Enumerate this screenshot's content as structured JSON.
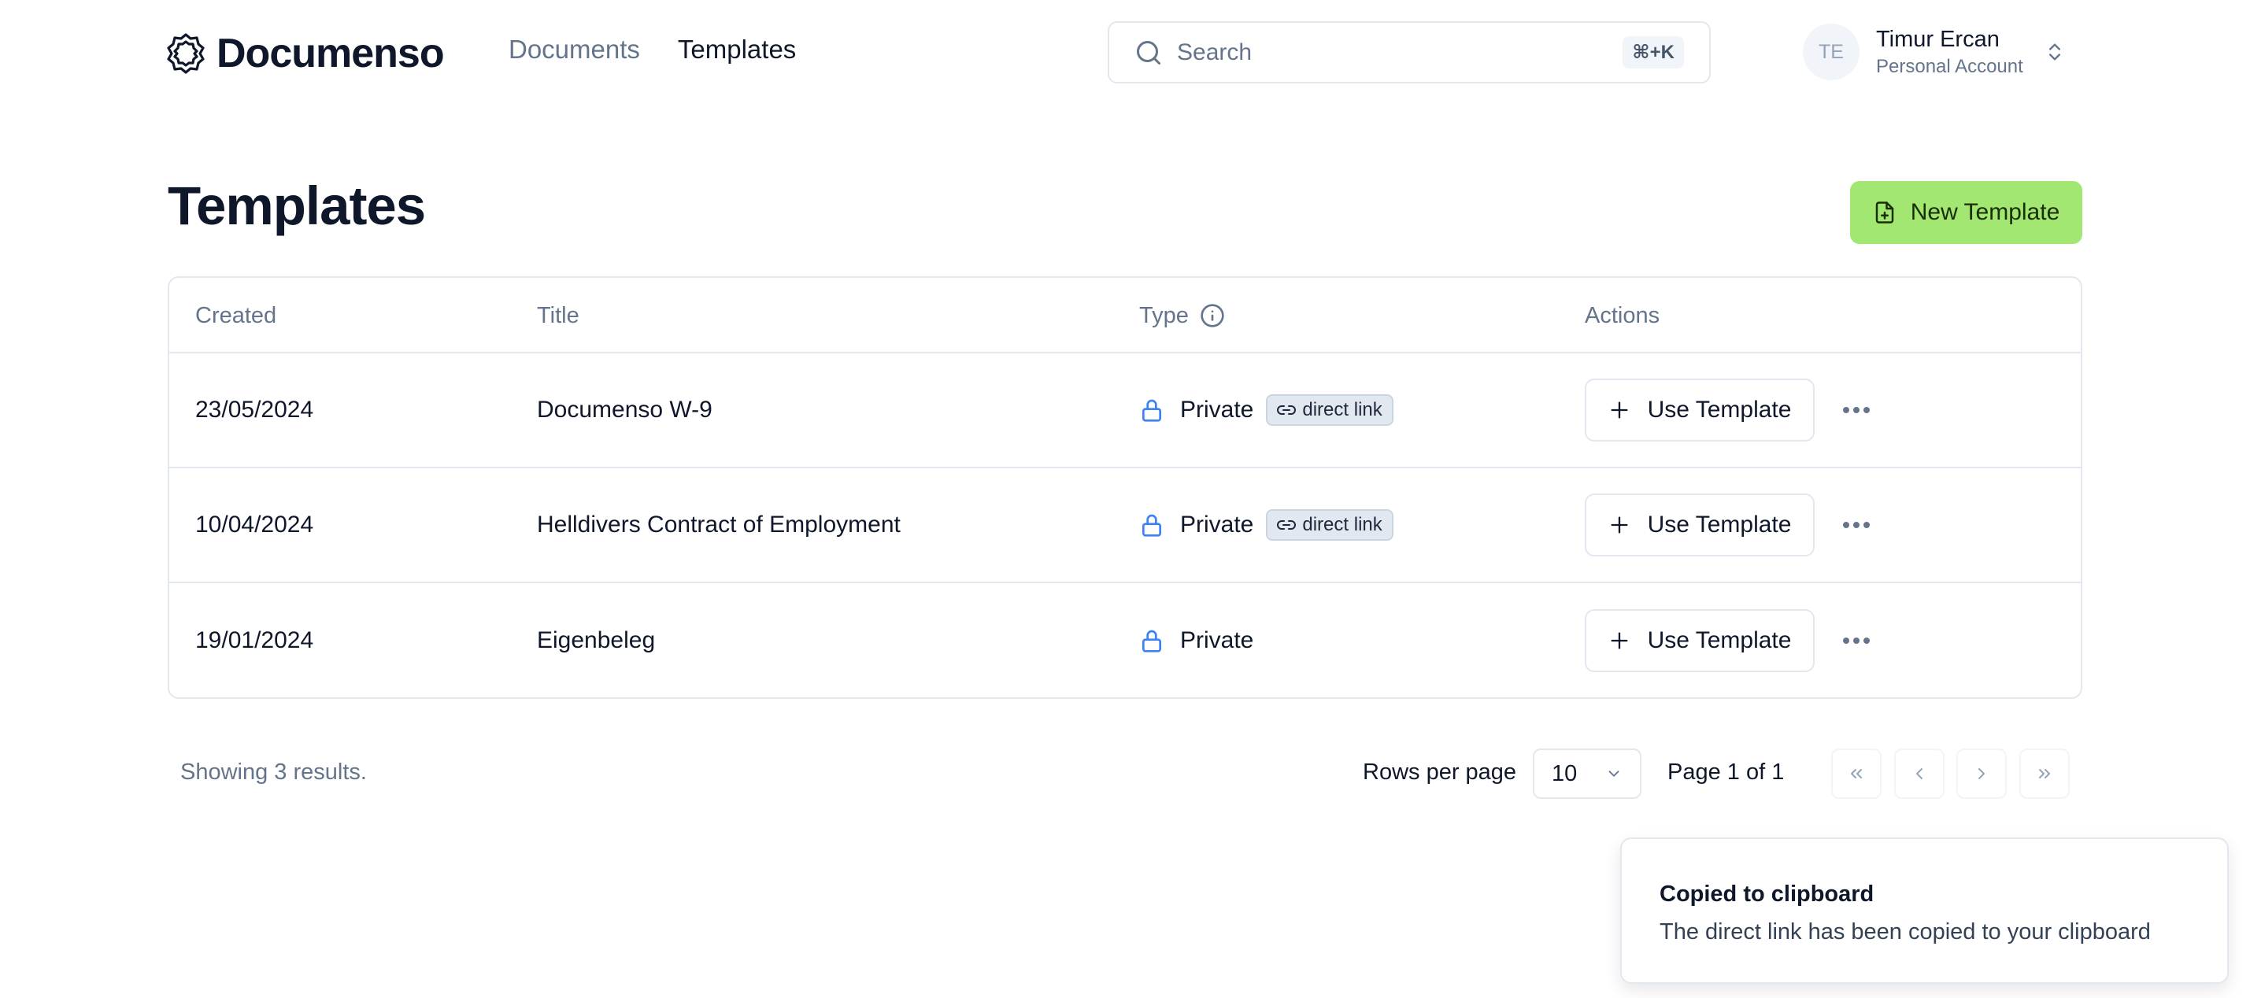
{
  "header": {
    "brand": "Documenso",
    "nav": [
      {
        "label": "Documents",
        "active": false
      },
      {
        "label": "Templates",
        "active": true
      }
    ],
    "search": {
      "placeholder": "Search",
      "shortcut": "⌘+K"
    },
    "account": {
      "initials": "TE",
      "name": "Timur Ercan",
      "type": "Personal Account"
    }
  },
  "page": {
    "title": "Templates",
    "new_button": "New Template",
    "accent_color": "#a2e771"
  },
  "table": {
    "columns": [
      "Created",
      "Title",
      "Type",
      "Actions"
    ],
    "rows": [
      {
        "created": "23/05/2024",
        "title": "Documenso W-9",
        "type": "Private",
        "badge": "direct link",
        "action": "Use Template"
      },
      {
        "created": "10/04/2024",
        "title": "Helldivers Contract of Employment",
        "type": "Private",
        "badge": "direct link",
        "action": "Use Template"
      },
      {
        "created": "19/01/2024",
        "title": "Eigenbeleg",
        "type": "Private",
        "badge": null,
        "action": "Use Template"
      }
    ]
  },
  "footer": {
    "showing": "Showing 3 results.",
    "rows_per_page_label": "Rows per page",
    "rows_per_page_value": "10",
    "page_info": "Page 1 of 1"
  },
  "toast": {
    "title": "Copied to clipboard",
    "description": "The direct link has been copied to your clipboard"
  }
}
